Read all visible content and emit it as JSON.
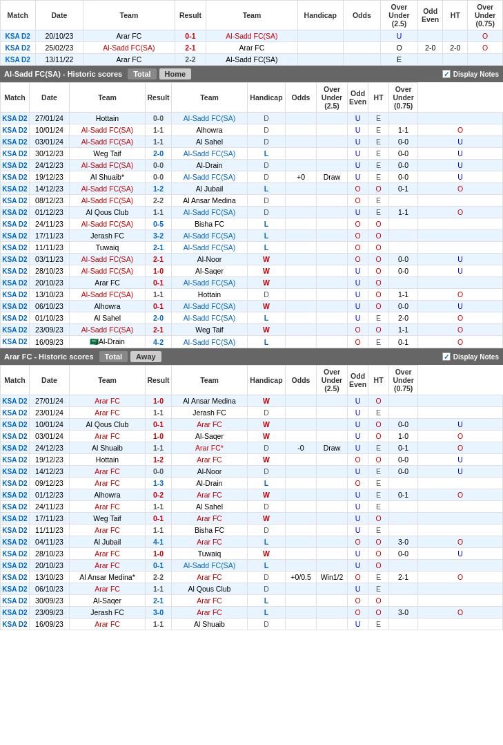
{
  "topSection": {
    "headers": [
      "Match",
      "Date",
      "Team",
      "Result",
      "Team",
      "Handicap",
      "Odds",
      "Over Under (2.5)",
      "Odd Even",
      "HT",
      "Over Under (0.75)"
    ],
    "rows": [
      {
        "match": "KSA D2",
        "date": "20/10/23",
        "team1": "Arar FC",
        "result": "0-1",
        "team2": "Al-Sadd FC(SA)",
        "handicap": "",
        "odds": "",
        "over": "",
        "oddEven": "U",
        "ht": "",
        "overUnder": "O",
        "resultColor": "red",
        "team1Color": "black",
        "team2Color": "red",
        "row": "light"
      },
      {
        "match": "KSA D2",
        "date": "25/02/23",
        "team1": "Al-Sadd FC(SA)",
        "result": "2-1",
        "team2": "Arar FC",
        "handicap": "",
        "odds": "",
        "over": "",
        "oddEven": "O",
        "ht": "2-0",
        "overUnder": "O",
        "resultColor": "red",
        "team1Color": "red",
        "team2Color": "black",
        "row": "white"
      },
      {
        "match": "KSA D2",
        "date": "13/11/22",
        "team1": "Arar FC",
        "result": "2-2",
        "team2": "Al-Sadd FC(SA)",
        "handicap": "",
        "odds": "",
        "over": "",
        "oddEven": "E",
        "ht": "",
        "overUnder": "",
        "resultColor": "draw",
        "team1Color": "black",
        "team2Color": "black",
        "row": "light"
      }
    ]
  },
  "alSaddSection": {
    "title": "Al-Sadd FC(SA) - Historic scores",
    "tabs": [
      "Total",
      "Home"
    ],
    "activeTab": "Home",
    "headers": [
      "Match",
      "Date",
      "Team",
      "Result",
      "Team",
      "Handicap",
      "Odds",
      "Over Under (2.5)",
      "Odd Even",
      "HT",
      "Over Under (0.75)"
    ],
    "rows": [
      {
        "match": "KSA D2",
        "date": "27/01/24",
        "team1": "Hottain",
        "result": "0-0",
        "team2": "Al-Sadd FC(SA)",
        "status": "D",
        "handicap": "",
        "odds": "",
        "over": "U",
        "oddEven": "E",
        "ht": "",
        "overUnder": "",
        "team1Color": "black",
        "team2Color": "blue",
        "row": "light"
      },
      {
        "match": "KSA D2",
        "date": "10/01/24",
        "team1": "Al-Sadd FC(SA)",
        "result": "1-1",
        "team2": "Alhowra",
        "status": "D",
        "handicap": "",
        "odds": "",
        "over": "U",
        "oddEven": "E",
        "ht": "1-1",
        "overUnder": "O",
        "team1Color": "red",
        "team2Color": "black",
        "row": "white"
      },
      {
        "match": "KSA D2",
        "date": "03/01/24",
        "team1": "Al-Sadd FC(SA)",
        "result": "1-1",
        "team2": "Al Sahel",
        "status": "D",
        "handicap": "",
        "odds": "",
        "over": "U",
        "oddEven": "E",
        "ht": "0-0",
        "overUnder": "U",
        "team1Color": "red",
        "team2Color": "black",
        "row": "light"
      },
      {
        "match": "KSA D2",
        "date": "30/12/23",
        "team1": "Weg Taif",
        "result": "2-0",
        "team2": "Al-Sadd FC(SA)",
        "status": "L",
        "handicap": "",
        "odds": "",
        "over": "U",
        "oddEven": "E",
        "ht": "0-0",
        "overUnder": "U",
        "team1Color": "black",
        "team2Color": "blue",
        "row": "white"
      },
      {
        "match": "KSA D2",
        "date": "24/12/23",
        "team1": "Al-Sadd FC(SA)",
        "result": "0-0",
        "team2": "Al-Drain",
        "status": "D",
        "handicap": "",
        "odds": "",
        "over": "U",
        "oddEven": "E",
        "ht": "0-0",
        "overUnder": "U",
        "team1Color": "red",
        "team2Color": "black",
        "row": "light"
      },
      {
        "match": "KSA D2",
        "date": "19/12/23",
        "team1": "Al Shuaib*",
        "result": "0-0",
        "team2": "Al-Sadd FC(SA)",
        "status": "D",
        "handicap": "+0",
        "odds": "Draw",
        "over": "U",
        "oddEven": "E",
        "ht": "0-0",
        "overUnder": "U",
        "team1Color": "black",
        "team2Color": "blue",
        "row": "white"
      },
      {
        "match": "KSA D2",
        "date": "14/12/23",
        "team1": "Al-Sadd FC(SA)",
        "result": "1-2",
        "team2": "Al Jubail",
        "status": "L",
        "handicap": "",
        "odds": "",
        "over": "O",
        "oddEven": "O",
        "ht": "0-1",
        "overUnder": "O",
        "team1Color": "red",
        "team2Color": "black",
        "row": "light"
      },
      {
        "match": "KSA D2",
        "date": "08/12/23",
        "team1": "Al-Sadd FC(SA)",
        "result": "2-2",
        "team2": "Al Ansar Medina",
        "status": "D",
        "handicap": "",
        "odds": "",
        "over": "O",
        "oddEven": "E",
        "ht": "",
        "overUnder": "",
        "team1Color": "red",
        "team2Color": "black",
        "row": "white"
      },
      {
        "match": "KSA D2",
        "date": "01/12/23",
        "team1": "Al Qous Club",
        "result": "1-1",
        "team2": "Al-Sadd FC(SA)",
        "status": "D",
        "handicap": "",
        "odds": "",
        "over": "U",
        "oddEven": "E",
        "ht": "1-1",
        "overUnder": "O",
        "team1Color": "black",
        "team2Color": "blue",
        "row": "light"
      },
      {
        "match": "KSA D2",
        "date": "24/11/23",
        "team1": "Al-Sadd FC(SA)",
        "result": "0-5",
        "team2": "Bisha FC",
        "status": "L",
        "handicap": "",
        "odds": "",
        "over": "O",
        "oddEven": "O",
        "ht": "",
        "overUnder": "",
        "team1Color": "red",
        "team2Color": "black",
        "row": "white"
      },
      {
        "match": "KSA D2",
        "date": "17/11/23",
        "team1": "Jerash FC",
        "result": "3-2",
        "team2": "Al-Sadd FC(SA)",
        "status": "L",
        "handicap": "",
        "odds": "",
        "over": "O",
        "oddEven": "O",
        "ht": "",
        "overUnder": "",
        "team1Color": "black",
        "team2Color": "blue",
        "row": "light"
      },
      {
        "match": "KSA D2",
        "date": "11/11/23",
        "team1": "Tuwaiq",
        "result": "2-1",
        "team2": "Al-Sadd FC(SA)",
        "status": "L",
        "handicap": "",
        "odds": "",
        "over": "O",
        "oddEven": "O",
        "ht": "",
        "overUnder": "",
        "team1Color": "black",
        "team2Color": "blue",
        "row": "white"
      },
      {
        "match": "KSA D2",
        "date": "03/11/23",
        "team1": "Al-Sadd FC(SA)",
        "result": "2-1",
        "team2": "Al-Noor",
        "status": "W",
        "handicap": "",
        "odds": "",
        "over": "O",
        "oddEven": "O",
        "ht": "0-0",
        "overUnder": "U",
        "team1Color": "red",
        "team2Color": "black",
        "row": "light"
      },
      {
        "match": "KSA D2",
        "date": "28/10/23",
        "team1": "Al-Sadd FC(SA)",
        "result": "1-0",
        "team2": "Al-Saqer",
        "status": "W",
        "handicap": "",
        "odds": "",
        "over": "U",
        "oddEven": "O",
        "ht": "0-0",
        "overUnder": "U",
        "team1Color": "red",
        "team2Color": "black",
        "row": "white"
      },
      {
        "match": "KSA D2",
        "date": "20/10/23",
        "team1": "Arar FC",
        "result": "0-1",
        "team2": "Al-Sadd FC(SA)",
        "status": "W",
        "handicap": "",
        "odds": "",
        "over": "U",
        "oddEven": "O",
        "ht": "",
        "overUnder": "",
        "team1Color": "black",
        "team2Color": "blue",
        "row": "light"
      },
      {
        "match": "KSA D2",
        "date": "13/10/23",
        "team1": "Al-Sadd FC(SA)",
        "result": "1-1",
        "team2": "Hottain",
        "status": "D",
        "handicap": "",
        "odds": "",
        "over": "U",
        "oddEven": "O",
        "ht": "1-1",
        "overUnder": "O",
        "team1Color": "red",
        "team2Color": "black",
        "row": "white"
      },
      {
        "match": "KSA D2",
        "date": "06/10/23",
        "team1": "Alhowra",
        "result": "0-1",
        "team2": "Al-Sadd FC(SA)",
        "status": "W",
        "handicap": "",
        "odds": "",
        "over": "U",
        "oddEven": "O",
        "ht": "0-0",
        "overUnder": "U",
        "team1Color": "black",
        "team2Color": "blue",
        "row": "light"
      },
      {
        "match": "KSA D2",
        "date": "01/10/23",
        "team1": "Al Sahel",
        "result": "2-0",
        "team2": "Al-Sadd FC(SA)",
        "status": "L",
        "handicap": "",
        "odds": "",
        "over": "U",
        "oddEven": "E",
        "ht": "2-0",
        "overUnder": "O",
        "team1Color": "black",
        "team2Color": "blue",
        "row": "white"
      },
      {
        "match": "KSA D2",
        "date": "23/09/23",
        "team1": "Al-Sadd FC(SA)",
        "result": "2-1",
        "team2": "Weg Taif",
        "status": "W",
        "handicap": "",
        "odds": "",
        "over": "O",
        "oddEven": "O",
        "ht": "1-1",
        "overUnder": "O",
        "team1Color": "red",
        "team2Color": "black",
        "row": "light"
      },
      {
        "match": "KSA D2",
        "date": "16/09/23",
        "team1": "Al-Drain",
        "result": "4-2",
        "team2": "Al-Sadd FC(SA)",
        "status": "L",
        "handicap": "",
        "odds": "",
        "over": "O",
        "oddEven": "E",
        "ht": "0-1",
        "overUnder": "O",
        "team1Color": "black",
        "team2Color": "blue",
        "row": "white",
        "flag": "🇸🇦"
      }
    ]
  },
  "ararSection": {
    "title": "Arar FC - Historic scores",
    "tabs": [
      "Total",
      "Away"
    ],
    "activeTab": "Away",
    "headers": [
      "Match",
      "Date",
      "Team",
      "Result",
      "Team",
      "Handicap",
      "Odds",
      "Over Under (2.5)",
      "Odd Even",
      "HT",
      "Over Under (0.75)"
    ],
    "rows": [
      {
        "match": "KSA D2",
        "date": "27/01/24",
        "team1": "Arar FC",
        "result": "1-0",
        "team2": "Al Ansar Medina",
        "status": "W",
        "handicap": "",
        "odds": "",
        "over": "U",
        "oddEven": "O",
        "ht": "",
        "overUnder": "",
        "team1Color": "red",
        "team2Color": "black",
        "row": "light"
      },
      {
        "match": "KSA D2",
        "date": "23/01/24",
        "team1": "Arar FC",
        "result": "1-1",
        "team2": "Jerash FC",
        "status": "D",
        "handicap": "",
        "odds": "",
        "over": "U",
        "oddEven": "E",
        "ht": "",
        "overUnder": "",
        "team1Color": "red",
        "team2Color": "black",
        "row": "white"
      },
      {
        "match": "KSA D2",
        "date": "10/01/24",
        "team1": "Al Qous Club",
        "result": "0-1",
        "team2": "Arar FC",
        "status": "W",
        "handicap": "",
        "odds": "",
        "over": "U",
        "oddEven": "O",
        "ht": "0-0",
        "overUnder": "U",
        "team1Color": "black",
        "team2Color": "red",
        "row": "light"
      },
      {
        "match": "KSA D2",
        "date": "03/01/24",
        "team1": "Arar FC",
        "result": "1-0",
        "team2": "Al-Saqer",
        "status": "W",
        "handicap": "",
        "odds": "",
        "over": "U",
        "oddEven": "O",
        "ht": "1-0",
        "overUnder": "O",
        "team1Color": "red",
        "team2Color": "black",
        "row": "white"
      },
      {
        "match": "KSA D2",
        "date": "24/12/23",
        "team1": "Al Shuaib",
        "result": "1-1",
        "team2": "Arar FC*",
        "status": "D",
        "handicap": "-0",
        "odds": "Draw",
        "over": "U",
        "oddEven": "E",
        "ht": "0-1",
        "overUnder": "O",
        "team1Color": "black",
        "team2Color": "red",
        "row": "light"
      },
      {
        "match": "KSA D2",
        "date": "19/12/23",
        "team1": "Hottain",
        "result": "1-2",
        "team2": "Arar FC",
        "status": "W",
        "handicap": "",
        "odds": "",
        "over": "O",
        "oddEven": "O",
        "ht": "0-0",
        "overUnder": "U",
        "team1Color": "black",
        "team2Color": "red",
        "row": "white"
      },
      {
        "match": "KSA D2",
        "date": "14/12/23",
        "team1": "Arar FC",
        "result": "0-0",
        "team2": "Al-Noor",
        "status": "D",
        "handicap": "",
        "odds": "",
        "over": "U",
        "oddEven": "E",
        "ht": "0-0",
        "overUnder": "U",
        "team1Color": "red",
        "team2Color": "black",
        "row": "light"
      },
      {
        "match": "KSA D2",
        "date": "09/12/23",
        "team1": "Arar FC",
        "result": "1-3",
        "team2": "Al-Drain",
        "status": "L",
        "handicap": "",
        "odds": "",
        "over": "O",
        "oddEven": "E",
        "ht": "",
        "overUnder": "",
        "team1Color": "red",
        "team2Color": "black",
        "row": "white"
      },
      {
        "match": "KSA D2",
        "date": "01/12/23",
        "team1": "Alhowra",
        "result": "0-2",
        "team2": "Arar FC",
        "status": "W",
        "handicap": "",
        "odds": "",
        "over": "U",
        "oddEven": "E",
        "ht": "0-1",
        "overUnder": "O",
        "team1Color": "black",
        "team2Color": "red",
        "row": "light"
      },
      {
        "match": "KSA D2",
        "date": "24/11/23",
        "team1": "Arar FC",
        "result": "1-1",
        "team2": "Al Sahel",
        "status": "D",
        "handicap": "",
        "odds": "",
        "over": "U",
        "oddEven": "E",
        "ht": "",
        "overUnder": "",
        "team1Color": "red",
        "team2Color": "black",
        "row": "white"
      },
      {
        "match": "KSA D2",
        "date": "17/11/23",
        "team1": "Weg Taif",
        "result": "0-1",
        "team2": "Arar FC",
        "status": "W",
        "handicap": "",
        "odds": "",
        "over": "U",
        "oddEven": "O",
        "ht": "",
        "overUnder": "",
        "team1Color": "black",
        "team2Color": "red",
        "row": "light"
      },
      {
        "match": "KSA D2",
        "date": "11/11/23",
        "team1": "Arar FC",
        "result": "1-1",
        "team2": "Bisha FC",
        "status": "D",
        "handicap": "",
        "odds": "",
        "over": "U",
        "oddEven": "E",
        "ht": "",
        "overUnder": "",
        "team1Color": "red",
        "team2Color": "black",
        "row": "white"
      },
      {
        "match": "KSA D2",
        "date": "04/11/23",
        "team1": "Al Jubail",
        "result": "4-1",
        "team2": "Arar FC",
        "status": "L",
        "handicap": "",
        "odds": "",
        "over": "O",
        "oddEven": "O",
        "ht": "3-0",
        "overUnder": "O",
        "team1Color": "black",
        "team2Color": "red",
        "row": "light"
      },
      {
        "match": "KSA D2",
        "date": "28/10/23",
        "team1": "Arar FC",
        "result": "1-0",
        "team2": "Tuwaiq",
        "status": "W",
        "handicap": "",
        "odds": "",
        "over": "U",
        "oddEven": "O",
        "ht": "0-0",
        "overUnder": "U",
        "team1Color": "red",
        "team2Color": "black",
        "row": "white"
      },
      {
        "match": "KSA D2",
        "date": "20/10/23",
        "team1": "Arar FC",
        "result": "0-1",
        "team2": "Al-Sadd FC(SA)",
        "status": "L",
        "handicap": "",
        "odds": "",
        "over": "U",
        "oddEven": "O",
        "ht": "",
        "overUnder": "",
        "team1Color": "red",
        "team2Color": "blue",
        "row": "light"
      },
      {
        "match": "KSA D2",
        "date": "13/10/23",
        "team1": "Al Ansar Medina*",
        "result": "2-2",
        "team2": "Arar FC",
        "status": "D",
        "handicap": "+0/0.5",
        "odds": "Win1/2",
        "over": "O",
        "oddEven": "E",
        "ht": "2-1",
        "overUnder": "O",
        "team1Color": "black",
        "team2Color": "red",
        "row": "white"
      },
      {
        "match": "KSA D2",
        "date": "06/10/23",
        "team1": "Arar FC",
        "result": "1-1",
        "team2": "Al Qous Club",
        "status": "D",
        "handicap": "",
        "odds": "",
        "over": "U",
        "oddEven": "E",
        "ht": "",
        "overUnder": "",
        "team1Color": "red",
        "team2Color": "black",
        "row": "light"
      },
      {
        "match": "KSA D2",
        "date": "30/09/23",
        "team1": "Al-Saqer",
        "result": "2-1",
        "team2": "Arar FC",
        "status": "L",
        "handicap": "",
        "odds": "",
        "over": "O",
        "oddEven": "O",
        "ht": "",
        "overUnder": "",
        "team1Color": "black",
        "team2Color": "red",
        "row": "white"
      },
      {
        "match": "KSA D2",
        "date": "23/09/23",
        "team1": "Jerash FC",
        "result": "3-0",
        "team2": "Arar FC",
        "status": "L",
        "handicap": "",
        "odds": "",
        "over": "O",
        "oddEven": "O",
        "ht": "3-0",
        "overUnder": "O",
        "team1Color": "black",
        "team2Color": "red",
        "row": "light"
      },
      {
        "match": "KSA D2",
        "date": "16/09/23",
        "team1": "Arar FC",
        "result": "1-1",
        "team2": "Al Shuaib",
        "status": "D",
        "handicap": "",
        "odds": "",
        "over": "U",
        "oddEven": "E",
        "ht": "",
        "overUnder": "",
        "team1Color": "red",
        "team2Color": "black",
        "row": "white"
      }
    ]
  },
  "colors": {
    "sectionHeaderBg": "#666666",
    "activeTabBg": "#cccccc",
    "inactiveTabBg": "#888888",
    "lightRowBg": "#e8f4ff",
    "whitRowBg": "#ffffff",
    "matchColor": "#0066cc",
    "redTeam": "#cc0000",
    "blueTeam": "#0066cc",
    "oddU": "#0000cc",
    "oddO": "#cc0000"
  }
}
